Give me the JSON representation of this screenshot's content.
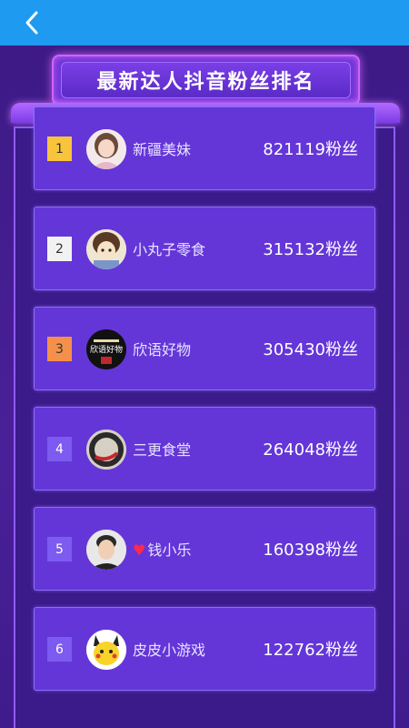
{
  "header": {
    "back_icon": "chevron-left-icon"
  },
  "title": "最新达人抖音粉丝排名",
  "colors": {
    "topbar": "#1e9af0",
    "rank_gold": "#f7c43c",
    "rank_silver": "#f2f2f2",
    "rank_bronze": "#f5904a",
    "rank_default": "#7d5af0",
    "heart": "#ff2a4a"
  },
  "rankings": [
    {
      "rank": "1",
      "name": "新疆美妹",
      "fans": "821119粉丝",
      "avatar_icon": "user-avatar-icon"
    },
    {
      "rank": "2",
      "name": "小丸子零食",
      "fans": "315132粉丝",
      "avatar_icon": "user-avatar-icon"
    },
    {
      "rank": "3",
      "name": "欣语好物",
      "fans": "305430粉丝",
      "avatar_icon": "shop-logo-icon",
      "avatar_text": "欣语好物"
    },
    {
      "rank": "4",
      "name": "三更食堂",
      "fans": "264048粉丝",
      "avatar_icon": "shop-logo-icon"
    },
    {
      "rank": "5",
      "name": "钱小乐",
      "fans": "160398粉丝",
      "avatar_icon": "user-avatar-icon",
      "heart_icon": "heart-icon"
    },
    {
      "rank": "6",
      "name": "皮皮小游戏",
      "fans": "122762粉丝",
      "avatar_icon": "cartoon-avatar-icon"
    }
  ]
}
